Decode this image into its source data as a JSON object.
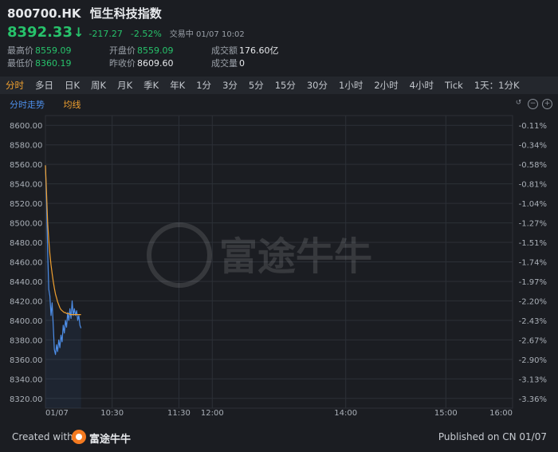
{
  "header": {
    "symbol": "800700.HK",
    "name": "恒生科技指数",
    "price": "8392.33",
    "arrow": "↓",
    "change": "-217.27",
    "change_pct": "-2.52%",
    "status": "交易中 01/07 10:02",
    "stats": {
      "high_label": "最高价",
      "high": "8559.09",
      "low_label": "最低价",
      "low": "8360.19",
      "open_label": "开盘价",
      "open": "8559.09",
      "prev_close_label": "昨收价",
      "prev_close": "8609.60",
      "turnover_label": "成交额",
      "turnover": "176.60亿",
      "volume_label": "成交量",
      "volume": "0"
    }
  },
  "tabs": [
    "分时",
    "多日",
    "日K",
    "周K",
    "月K",
    "季K",
    "年K",
    "1分",
    "3分",
    "5分",
    "15分",
    "30分",
    "1小时",
    "2小时",
    "4小时",
    "Tick",
    "1天：1分K"
  ],
  "active_tab": "分时",
  "legend": {
    "line": "分时走势",
    "avg": "均线"
  },
  "colors": {
    "price_line": "#4d8ee8",
    "avg_line": "#f0a030",
    "down": "#27c26b",
    "accent": "#f0a030"
  },
  "watermark": "富途牛牛",
  "footer": {
    "created": "Created with",
    "brand": "富途牛牛",
    "published": "Published on CN 01/07"
  },
  "chart_data": {
    "type": "line",
    "x_tick_labels": [
      "01/07",
      "10:30",
      "11:30",
      "12:00",
      "14:00",
      "15:00",
      "16:00"
    ],
    "x_tick_minutes": [
      0,
      60,
      120,
      150,
      270,
      360,
      420
    ],
    "y_ticks": [
      8600,
      8580,
      8560,
      8540,
      8520,
      8500,
      8480,
      8460,
      8440,
      8420,
      8400,
      8380,
      8360,
      8340,
      8320
    ],
    "y_tick_labels": [
      "8600.00",
      "8580.00",
      "8560.00",
      "8540.00",
      "8520.00",
      "8500.00",
      "8480.00",
      "8460.00",
      "8440.00",
      "8420.00",
      "8400.00",
      "8380.00",
      "8360.00",
      "8340.00",
      "8320.00"
    ],
    "pct_tick_labels": [
      "-0.11%",
      "-0.34%",
      "-0.58%",
      "-0.81%",
      "-1.04%",
      "-1.27%",
      "-1.51%",
      "-1.74%",
      "-1.97%",
      "-2.20%",
      "-2.43%",
      "-2.67%",
      "-2.90%",
      "-3.13%",
      "-3.36%"
    ],
    "ylim": [
      8310,
      8610
    ],
    "xlim": [
      0,
      420
    ],
    "grid": true,
    "series": [
      {
        "name": "分时走势",
        "x": [
          0,
          1,
          2,
          3,
          4,
          5,
          6,
          7,
          8,
          9,
          10,
          11,
          12,
          13,
          14,
          15,
          16,
          17,
          18,
          19,
          20,
          21,
          22,
          23,
          24,
          25,
          26,
          27,
          28,
          29,
          30,
          31,
          32
        ],
        "values": [
          8559,
          8520,
          8470,
          8432,
          8425,
          8405,
          8418,
          8395,
          8370,
          8365,
          8375,
          8368,
          8380,
          8372,
          8385,
          8378,
          8395,
          8387,
          8400,
          8393,
          8408,
          8400,
          8412,
          8402,
          8420,
          8405,
          8412,
          8405,
          8410,
          8400,
          8405,
          8395,
          8392
        ]
      },
      {
        "name": "均线",
        "x": [
          0,
          1,
          2,
          3,
          4,
          5,
          6,
          7,
          8,
          9,
          10,
          11,
          12,
          13,
          14,
          15,
          16,
          17,
          18,
          19,
          20,
          21,
          22,
          23,
          24,
          25,
          26,
          27,
          28,
          29,
          30,
          31,
          32
        ],
        "values": [
          8559,
          8530,
          8500,
          8482,
          8468,
          8457,
          8448,
          8440,
          8433,
          8427,
          8423,
          8419,
          8416,
          8413,
          8411,
          8410,
          8409,
          8408,
          8408,
          8407,
          8407,
          8407,
          8406,
          8406,
          8406,
          8406,
          8406,
          8406,
          8406,
          8406,
          8406,
          8406,
          8406
        ]
      }
    ]
  }
}
